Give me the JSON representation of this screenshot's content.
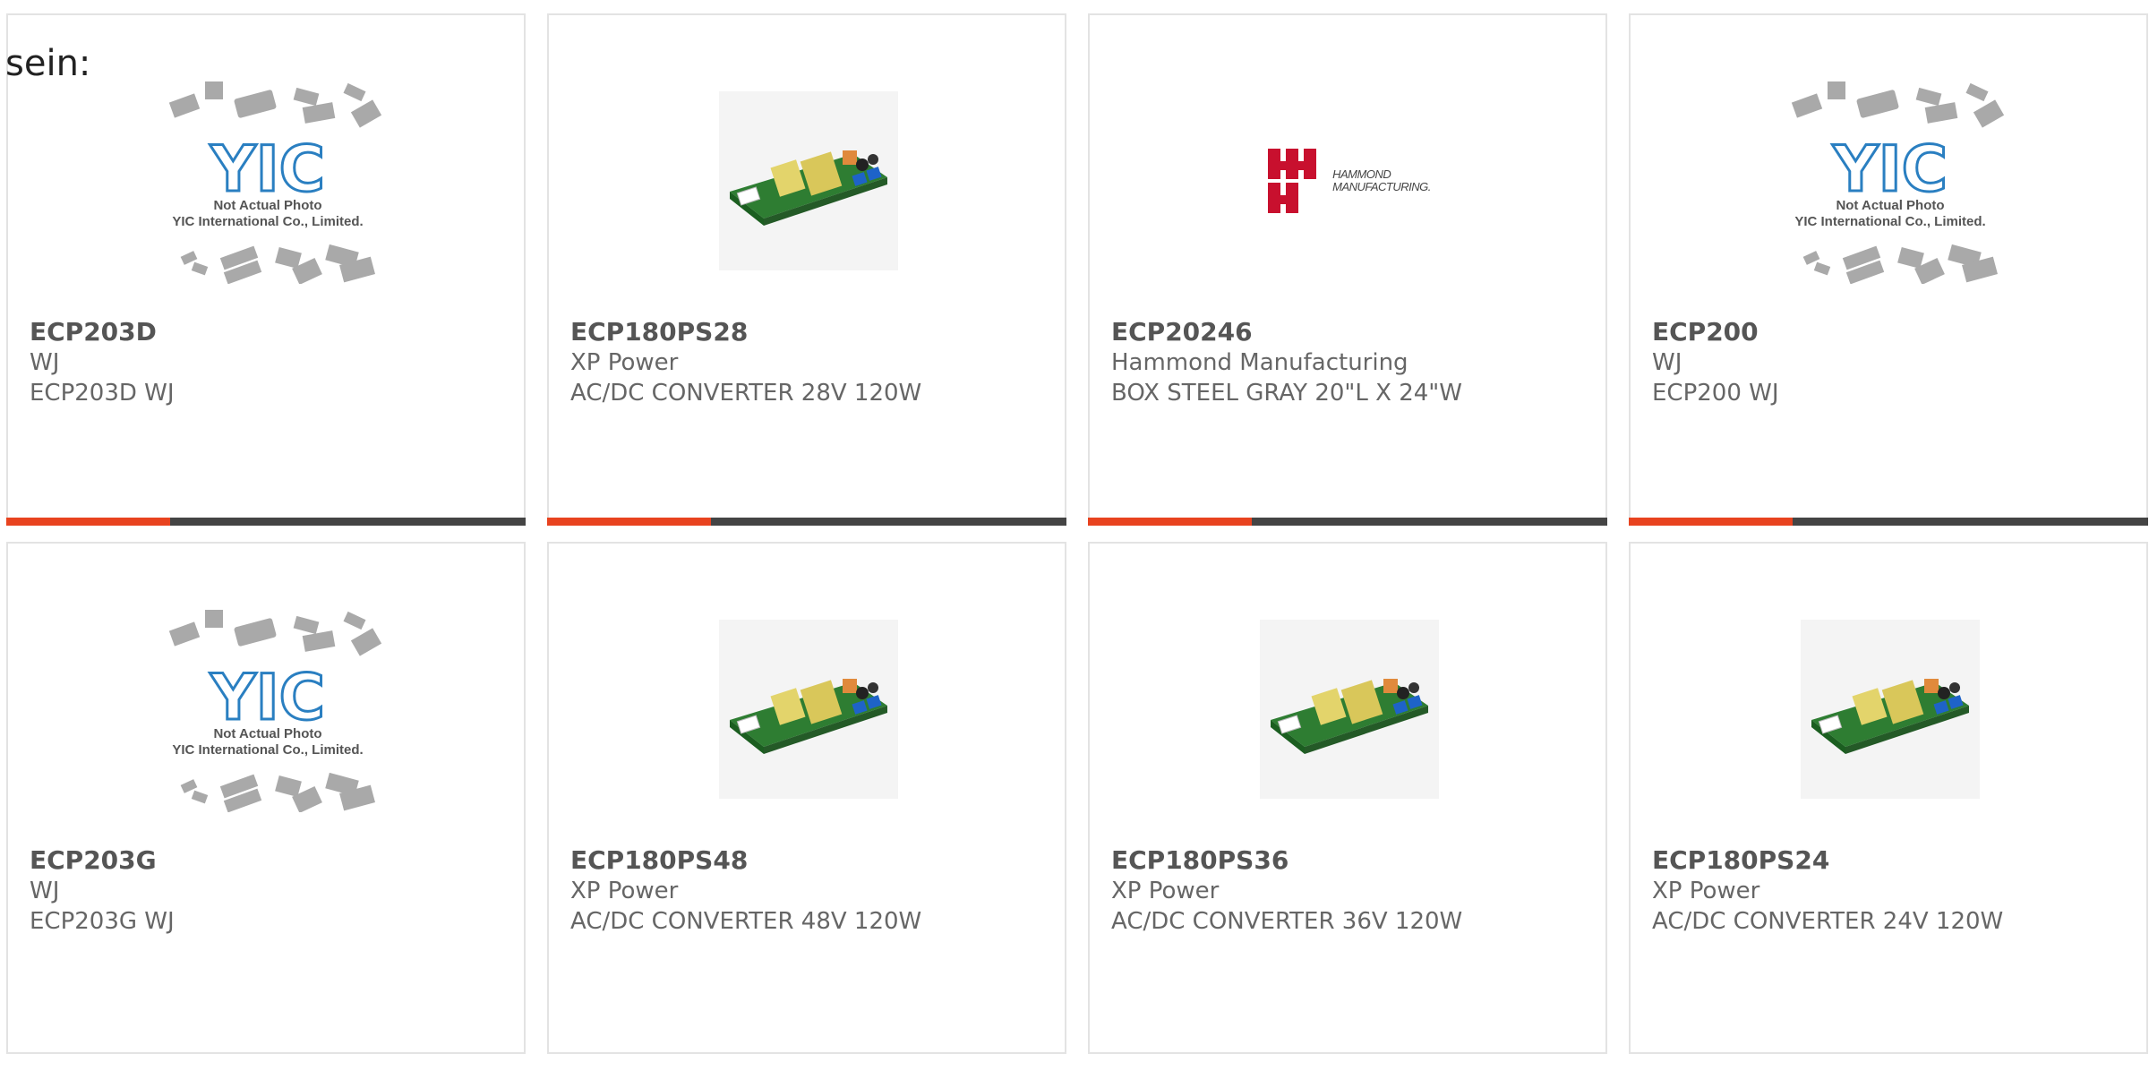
{
  "intro_text": "sein:",
  "placeholder": {
    "logo": "YIC",
    "line1": "Not Actual Photo",
    "line2": "YIC International Co., Limited."
  },
  "hammond_logo": {
    "line1": "HAMMOND",
    "line2": "MANUFACTURING."
  },
  "colors": {
    "accent": "#e8431f",
    "bar_dark": "#444444",
    "card_border": "#e3e3e3",
    "logo_blue": "#2a7fc1",
    "hammond_red": "#c8102e"
  },
  "products": [
    {
      "part": "ECP203D",
      "manufacturer": "WJ",
      "description": "ECP203D WJ",
      "image": "yic-placeholder"
    },
    {
      "part": "ECP180PS28",
      "manufacturer": "XP Power",
      "description": "AC/DC CONVERTER 28V 120W",
      "image": "power-supply-board"
    },
    {
      "part": "ECP20246",
      "manufacturer": "Hammond Manufacturing",
      "description": "BOX STEEL GRAY 20\"L X 24\"W",
      "image": "hammond-logo"
    },
    {
      "part": "ECP200",
      "manufacturer": "WJ",
      "description": "ECP200 WJ",
      "image": "yic-placeholder"
    },
    {
      "part": "ECP203G",
      "manufacturer": "WJ",
      "description": "ECP203G WJ",
      "image": "yic-placeholder"
    },
    {
      "part": "ECP180PS48",
      "manufacturer": "XP Power",
      "description": "AC/DC CONVERTER 48V 120W",
      "image": "power-supply-board"
    },
    {
      "part": "ECP180PS36",
      "manufacturer": "XP Power",
      "description": "AC/DC CONVERTER 36V 120W",
      "image": "power-supply-board"
    },
    {
      "part": "ECP180PS24",
      "manufacturer": "XP Power",
      "description": "AC/DC CONVERTER 24V 120W",
      "image": "power-supply-board"
    }
  ]
}
